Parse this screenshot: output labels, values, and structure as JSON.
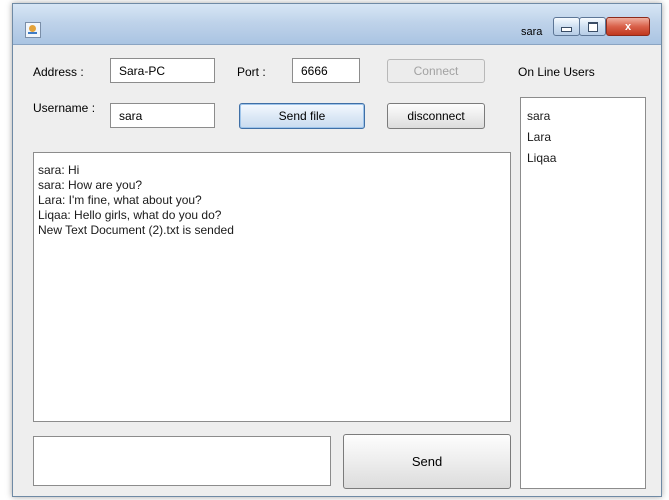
{
  "window": {
    "title": "sara",
    "min_glyph": "",
    "max_glyph": "",
    "close_glyph": "x"
  },
  "connection": {
    "address_label": "Address :",
    "address_value": "Sara-PC",
    "port_label": "Port :",
    "port_value": "6666",
    "connect_label": "Connect",
    "username_label": "Username :",
    "username_value": "sara",
    "send_file_label": "Send file",
    "disconnect_label": "disconnect"
  },
  "online_users": {
    "heading": "On Line Users",
    "users": [
      "sara",
      "Lara",
      "Liqaa"
    ]
  },
  "chat": {
    "lines": [
      "sara:  Hi",
      "sara:  How are you?",
      "Lara:  I'm fine, what about you?",
      "Liqaa:  Hello girls, what do you do?",
      "New Text Document (2).txt is sended"
    ]
  },
  "compose": {
    "message_value": "",
    "send_label": "Send"
  }
}
